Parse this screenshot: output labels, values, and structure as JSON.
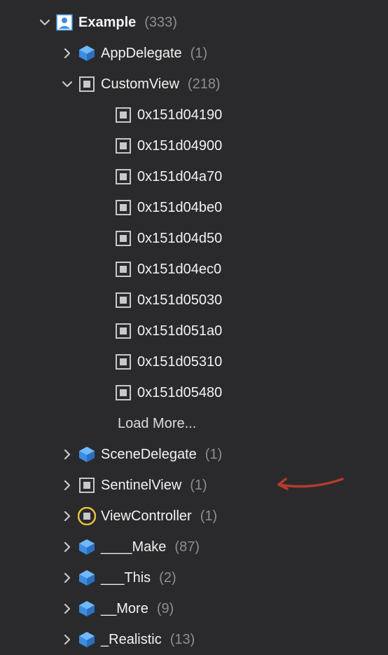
{
  "root": {
    "label": "Example",
    "count": "(333)"
  },
  "children": {
    "appDelegate": {
      "label": "AppDelegate",
      "count": "(1)"
    },
    "customView": {
      "label": "CustomView",
      "count": "(218)"
    },
    "sceneDelegate": {
      "label": "SceneDelegate",
      "count": "(1)"
    },
    "sentinelView": {
      "label": "SentinelView",
      "count": "(1)"
    },
    "viewController": {
      "label": "ViewController",
      "count": "(1)"
    },
    "make": {
      "label": "____Make",
      "count": "(87)"
    },
    "this": {
      "label": "___This",
      "count": "(2)"
    },
    "more": {
      "label": "__More",
      "count": "(9)"
    },
    "realistic": {
      "label": "_Realistic",
      "count": "(13)"
    }
  },
  "instances": [
    "0x151d04190",
    "0x151d04900",
    "0x151d04a70",
    "0x151d04be0",
    "0x151d04d50",
    "0x151d04ec0",
    "0x151d05030",
    "0x151d051a0",
    "0x151d05310",
    "0x151d05480"
  ],
  "loadMore": "Load More..."
}
